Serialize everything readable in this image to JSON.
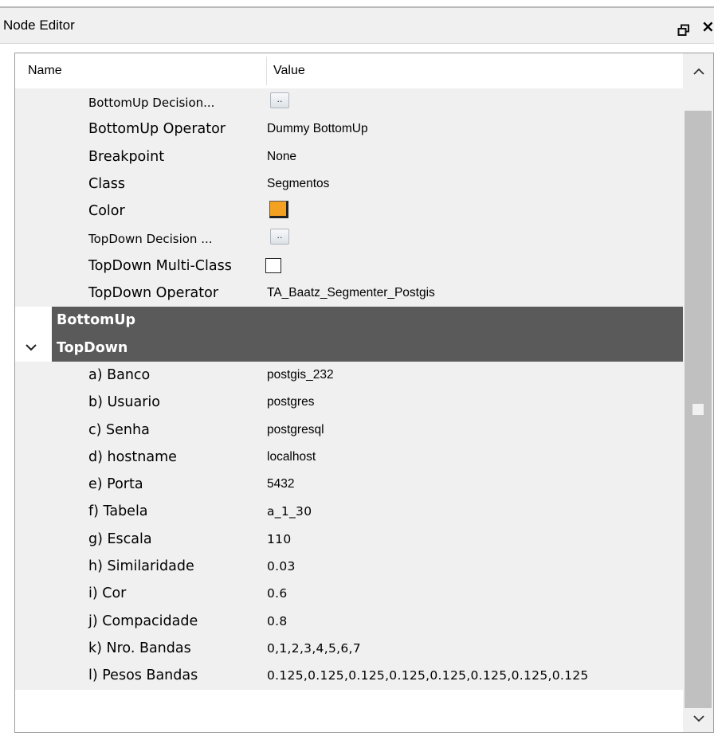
{
  "window": {
    "title": "Node Editor",
    "float_icon": "float-window-icon",
    "close_icon": "close-icon",
    "close_glyph": "×"
  },
  "table": {
    "col_name": "Name",
    "col_value": "Value"
  },
  "properties": [
    {
      "name": "BottomUp Decision...",
      "editor": "ellipsis",
      "button_label": "..",
      "small": true
    },
    {
      "name": "BottomUp Operator",
      "value": "Dummy BottomUp"
    },
    {
      "name": "Breakpoint",
      "value": "None"
    },
    {
      "name": "Class",
      "value": "Segmentos"
    },
    {
      "name": "Color",
      "editor": "color",
      "color": "#f4a020"
    },
    {
      "name": "TopDown Decision ...",
      "editor": "ellipsis",
      "button_label": "..",
      "small": true
    },
    {
      "name": "TopDown Multi-Class",
      "editor": "checkbox",
      "checked": false
    },
    {
      "name": "TopDown Operator",
      "value": "TA_Baatz_Segmenter_Postgis"
    }
  ],
  "categories": [
    {
      "label": "BottomUp",
      "expanded": false
    },
    {
      "label": "TopDown",
      "expanded": true
    }
  ],
  "topdown_params": [
    {
      "name": "a) Banco",
      "value": "postgis_232"
    },
    {
      "name": "b) Usuario",
      "value": "postgres"
    },
    {
      "name": "c) Senha",
      "value": "postgresql"
    },
    {
      "name": "d) hostname",
      "value": "localhost"
    },
    {
      "name": "e) Porta",
      "value": "5432"
    },
    {
      "name": "f) Tabela",
      "value": "a_1_30",
      "mono": true
    },
    {
      "name": "g) Escala",
      "value": "110",
      "mono": true
    },
    {
      "name": "h) Similaridade",
      "value": "0.03",
      "mono": true
    },
    {
      "name": "i) Cor",
      "value": "0.6",
      "mono": true
    },
    {
      "name": "j) Compacidade",
      "value": "0.8",
      "mono": true
    },
    {
      "name": "k) Nro. Bandas",
      "value": "0,1,2,3,4,5,6,7",
      "mono": true
    },
    {
      "name": "l) Pesos Bandas",
      "value": "0.125,0.125,0.125,0.125,0.125,0.125,0.125,0.125",
      "mono": true
    }
  ],
  "colors": {
    "category_bg": "#5a5a5a",
    "row_bg": "#f0f0f0",
    "scroll_thumb": "#c0c0c0"
  }
}
